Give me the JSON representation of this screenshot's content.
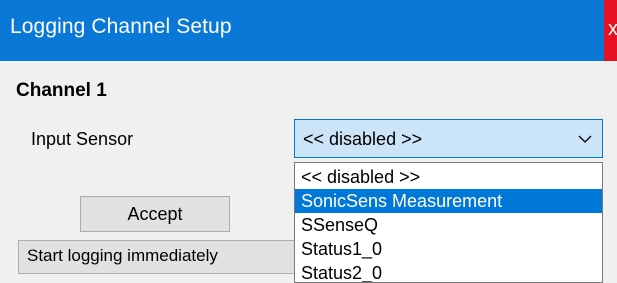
{
  "window": {
    "title": "Logging Channel Setup",
    "close_glyph": "x"
  },
  "channel": {
    "heading": "Channel 1",
    "input_sensor_label": "Input Sensor",
    "selected_value": "<< disabled >>"
  },
  "buttons": {
    "accept_label": "Accept"
  },
  "start_option": {
    "value": "Start logging immediately"
  },
  "dropdown": {
    "items": [
      {
        "label": "<< disabled >>"
      },
      {
        "label": "SonicSens Measurement"
      },
      {
        "label": "SSenseQ"
      },
      {
        "label": "Status1_0"
      },
      {
        "label": "Status2_0"
      }
    ],
    "highlighted_item": "SonicSens Measurement"
  },
  "colors": {
    "titlebar": "#0a78d7",
    "highlight": "#0078d7",
    "combo_background": "#cce4f7",
    "window_background": "#f0f0f0",
    "close_button": "#e81123"
  },
  "icons": {
    "combo_arrow": "chevron-down-icon"
  }
}
